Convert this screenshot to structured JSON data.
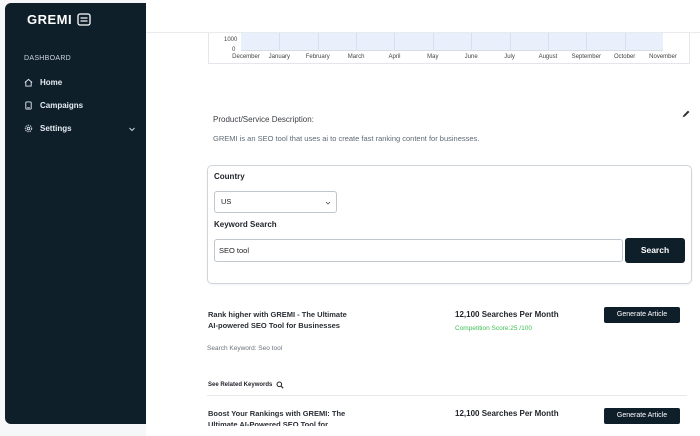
{
  "sidebar": {
    "logo": "GREMI",
    "section": "DASHBOARD",
    "items": [
      {
        "label": "Home",
        "icon": "home-icon"
      },
      {
        "label": "Campaigns",
        "icon": "campaigns-icon"
      },
      {
        "label": "Settings",
        "icon": "gear-icon"
      }
    ]
  },
  "chart_data": {
    "type": "bar",
    "categories": [
      "December",
      "January",
      "February",
      "March",
      "April",
      "May",
      "June",
      "July",
      "August",
      "September",
      "October",
      "November"
    ],
    "y_ticks": [
      "1000",
      "0"
    ],
    "grid": true
  },
  "description": {
    "label": "Product/Service Description:",
    "text": "GREMI is an SEO tool that uses ai to create fast ranking content for businesses."
  },
  "search": {
    "country_label": "Country",
    "country_value": "US",
    "keyword_label": "Keyword Search",
    "keyword_value": "SEO tool",
    "button": "Search"
  },
  "results": [
    {
      "title": "Rank higher with GREMI - The Ultimate AI-powered SEO Tool for Businesses",
      "keyword": "Search Keyword: Seo tool",
      "searches": "12,100 Searches Per Month",
      "competition": "Competition Score:25 /100",
      "button": "Generate Article"
    },
    {
      "title": "Boost Your Rankings with GREMI: The Ultimate AI-Powered SEO Tool for",
      "searches": "12,100 Searches Per Month",
      "button": "Generate Article"
    }
  ],
  "related": {
    "label": "See Related Keywords"
  },
  "colors": {
    "sidebar": "#0f1f2a",
    "accent": "#0f1f2a",
    "competition": "#3fbf55"
  }
}
